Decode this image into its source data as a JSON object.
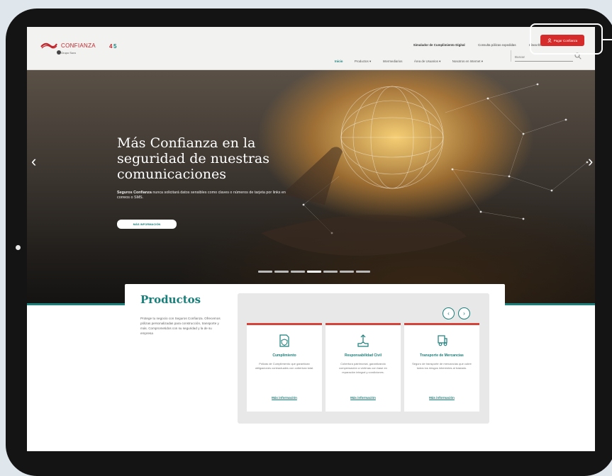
{
  "header": {
    "brand_name": "CONFIANZA",
    "brand_sub": "Grupo Sura",
    "top_links": [
      "Simulador de Cumplimiento Digital",
      "Consulta pólizas expedidas",
      "Línea Éti..."
    ],
    "pay_label": "Pagar Confianza",
    "nav": [
      "Inicio",
      "Productos",
      "Intermediarios",
      "Área de Usuarios",
      "Nosotros en Internet"
    ],
    "search_placeholder": "Buscar"
  },
  "hero": {
    "title": "Más Confianza en la seguridad de nuestras comunicaciones",
    "text_strong": "Seguros Confianza",
    "text": " nunca solicitará datos sensibles como claves o números de tarjeta por links en correos o SMS.",
    "button_label": "MÁS INFORMACIÓN",
    "slide_count": 7,
    "active_slide": 4
  },
  "products": {
    "title": "Productos",
    "description": "Protege tu negocio con Seguros Confianza. Ofrecemos pólizas personalizadas para construcción, transporte y más. Comprometidos con su seguridad y la de su empresa",
    "cards": [
      {
        "icon": "document-shield-icon",
        "title": "Cumplimiento",
        "description": "Pólizas de Cumplimiento que garantizan obligaciones contractuales con cobertura total.",
        "link": "Más información"
      },
      {
        "icon": "scale-hand-icon",
        "title": "Responsabilidad Civil",
        "description": "Cobertura patrimonial, garantizando compensación a víctimas con base en reparación integral y condiciones.",
        "link": "Más información"
      },
      {
        "icon": "truck-icon",
        "title": "Transporte de Mercancías",
        "description": "Seguro de transporte de mercancías que cubre todos los riesgos inherentes al traslado.",
        "link": "Más información"
      }
    ]
  },
  "colors": {
    "accent": "#1a7f7a",
    "brand_red": "#d62b2b"
  }
}
